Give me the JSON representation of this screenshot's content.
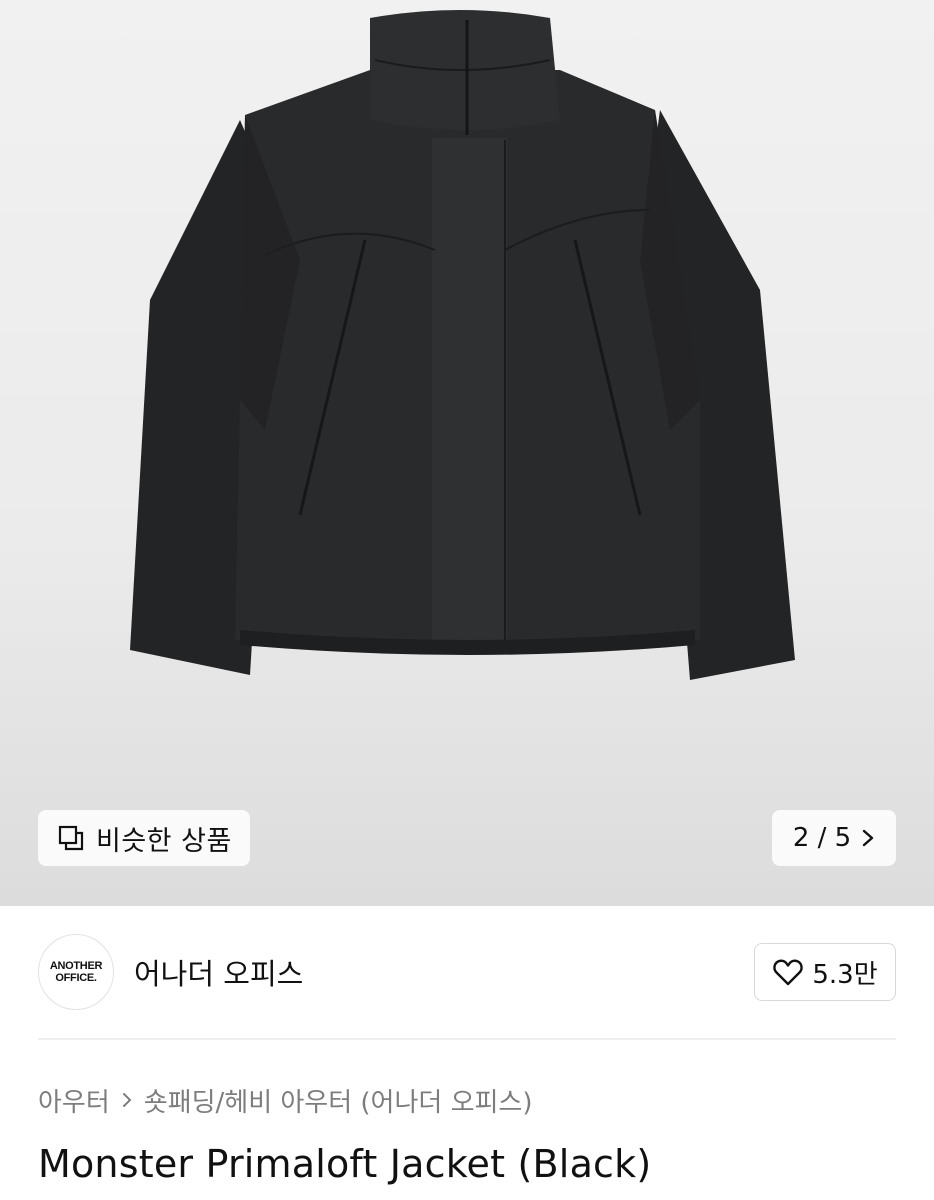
{
  "hero": {
    "image_alt": "Monster Primaloft Jacket (Black)",
    "similar_button": {
      "label": "비슷한 상품",
      "icon": "copy-icon"
    },
    "pager": {
      "current": 2,
      "total": 5,
      "text": "2 / 5",
      "icon": "chevron-right-icon"
    }
  },
  "brand": {
    "logo_line1": "ANOTHER",
    "logo_line2": "OFFICE.",
    "name": "어나더 오피스",
    "like": {
      "count": "5.3만",
      "icon": "heart-icon"
    }
  },
  "breadcrumb": {
    "items": [
      "아우터",
      "숏패딩/헤비 아우터 (어나더 오피스)"
    ],
    "separator_icon": "chevron-right-icon"
  },
  "product": {
    "title": "Monster Primaloft Jacket (Black)"
  }
}
